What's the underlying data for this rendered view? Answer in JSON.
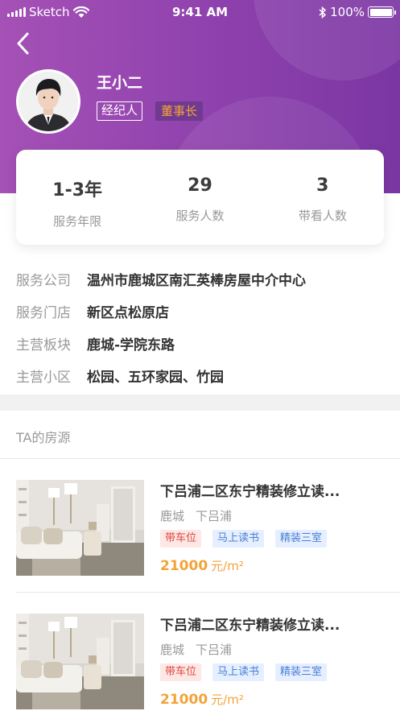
{
  "status_bar": {
    "carrier": "Sketch",
    "time": "9:41 AM",
    "battery": "100%"
  },
  "colors": {
    "header_start": "#a551b6",
    "header_end": "#7b36a3",
    "price": "#f3a33a",
    "tag_red": "#e0463c",
    "tag_blue": "#4a7fd6"
  },
  "profile": {
    "name": "王小二",
    "role": "经纪人",
    "title": "董事长"
  },
  "stats": [
    {
      "value": "1-3年",
      "label": "服务年限"
    },
    {
      "value": "29",
      "label": "服务人数"
    },
    {
      "value": "3",
      "label": "带看人数"
    }
  ],
  "info": [
    {
      "label": "服务公司",
      "value": "温州市鹿城区南汇英棒房屋中介中心"
    },
    {
      "label": "服务门店",
      "value": "新区点松原店"
    },
    {
      "label": "主营板块",
      "value": "鹿城-学院东路"
    },
    {
      "label": "主营小区",
      "value": "松园、五环家园、竹园"
    }
  ],
  "listings_section": {
    "title": "TA的房源"
  },
  "listings": [
    {
      "title": "下吕浦二区东宁精装修立读...",
      "district": "鹿城",
      "area": "下吕浦",
      "tags": [
        "带车位",
        "马上读书",
        "精装三室"
      ],
      "price": "21000",
      "unit": "元/m²"
    },
    {
      "title": "下吕浦二区东宁精装修立读...",
      "district": "鹿城",
      "area": "下吕浦",
      "tags": [
        "带车位",
        "马上读书",
        "精装三室"
      ],
      "price": "21000",
      "unit": "元/m²"
    }
  ]
}
